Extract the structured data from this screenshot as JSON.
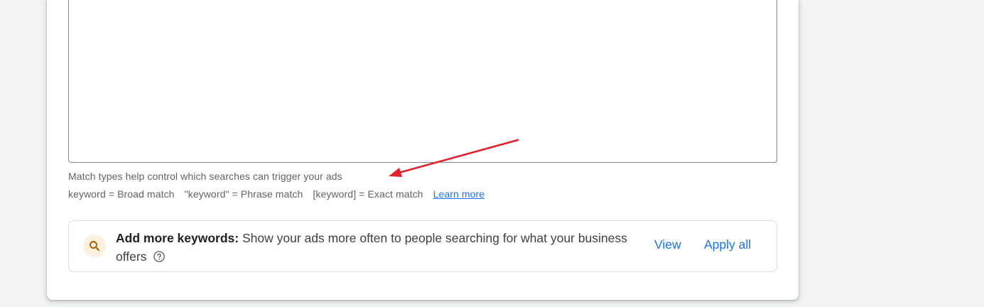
{
  "keywords_field": {
    "value": ""
  },
  "match_types": {
    "help_text": "Match types help control which searches can trigger your ads",
    "broad": "keyword = Broad match",
    "phrase": "\"keyword\" = Phrase match",
    "exact": "[keyword] = Exact match",
    "learn_more": "Learn more"
  },
  "suggestion": {
    "title": "Add more keywords:",
    "body": "Show your ads more often to people searching for what your business offers",
    "icon": "search-icon",
    "view_label": "View",
    "apply_all_label": "Apply all"
  },
  "colors": {
    "link": "#1a73e8",
    "annotation_arrow": "#e0202a",
    "icon_bg": "#fef0e1",
    "icon_fg": "#b06000"
  }
}
